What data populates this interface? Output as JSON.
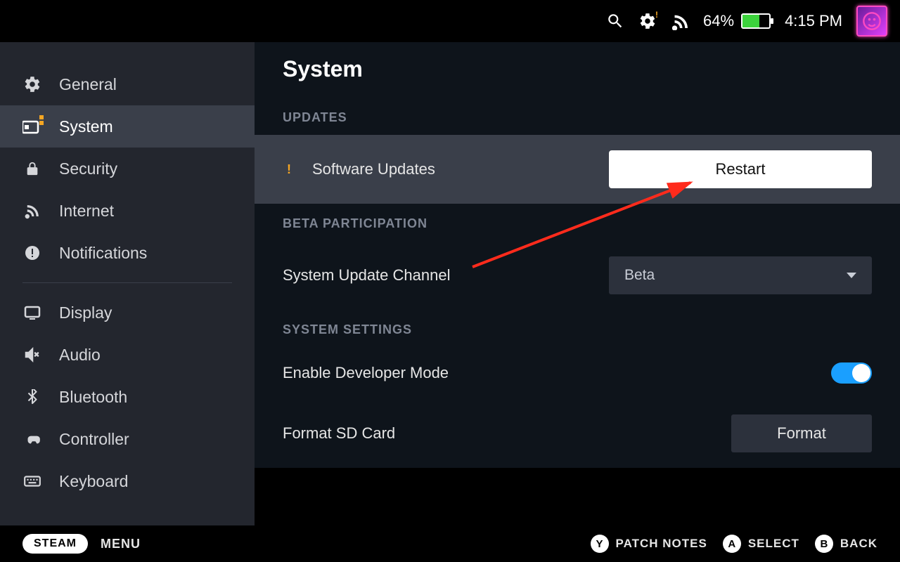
{
  "topbar": {
    "battery_pct": "64%",
    "clock": "4:15 PM"
  },
  "sidebar": {
    "items": [
      {
        "label": "General"
      },
      {
        "label": "System"
      },
      {
        "label": "Security"
      },
      {
        "label": "Internet"
      },
      {
        "label": "Notifications"
      },
      {
        "label": "Display"
      },
      {
        "label": "Audio"
      },
      {
        "label": "Bluetooth"
      },
      {
        "label": "Controller"
      },
      {
        "label": "Keyboard"
      }
    ]
  },
  "page": {
    "title": "System",
    "updates_label": "UPDATES",
    "software_updates": "Software Updates",
    "restart": "Restart",
    "beta_label": "BETA PARTICIPATION",
    "update_channel": "System Update Channel",
    "channel_value": "Beta",
    "settings_label": "SYSTEM SETTINGS",
    "dev_mode": "Enable Developer Mode",
    "format_sd": "Format SD Card",
    "format_btn": "Format"
  },
  "bottombar": {
    "steam": "STEAM",
    "menu": "MENU",
    "buttons": [
      {
        "key": "Y",
        "label": "PATCH NOTES"
      },
      {
        "key": "A",
        "label": "SELECT"
      },
      {
        "key": "B",
        "label": "BACK"
      }
    ]
  }
}
